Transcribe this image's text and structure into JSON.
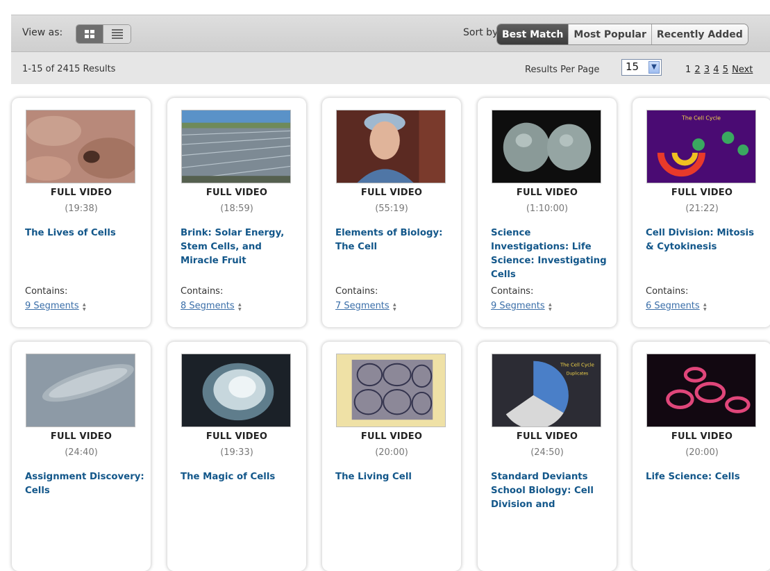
{
  "toolbar": {
    "view_label": "View as:",
    "view_modes": [
      {
        "name": "grid",
        "icon": "grid-icon",
        "active": true
      },
      {
        "name": "list",
        "icon": "list-icon",
        "active": false
      }
    ],
    "sort_label": "Sort by:",
    "sort_options": [
      "Best Match",
      "Most Popular",
      "Recently Added"
    ],
    "sort_active": "Best Match",
    "results_count": "1-15 of 2415 Results",
    "results_per_page_label": "Results Per Page",
    "results_per_page_value": "15",
    "pages": [
      "1",
      "2",
      "3",
      "4",
      "5"
    ],
    "current_page": "1",
    "next_label": "Next"
  },
  "cards": [
    {
      "type": "FULL VIDEO",
      "duration": "(19:38)",
      "title": "The Lives of Cells",
      "contains": "Contains:",
      "segments": "9 Segments",
      "thumb": "microscopic-cell-surface"
    },
    {
      "type": "FULL VIDEO",
      "duration": "(18:59)",
      "title": "Brink: Solar Energy, Stem Cells, and Miracle Fruit",
      "contains": "Contains:",
      "segments": "8 Segments",
      "thumb": "solar-panel-field"
    },
    {
      "type": "FULL VIDEO",
      "duration": "(55:19)",
      "title": "Elements of Biology: The Cell",
      "contains": "Contains:",
      "segments": "7 Segments",
      "thumb": "surgeon-portrait"
    },
    {
      "type": "FULL VIDEO",
      "duration": "(1:10:00)",
      "title": "Science Investigations: Life Science: Investigating Cells",
      "contains": "Contains:",
      "segments": "9 Segments",
      "thumb": "dividing-cells"
    },
    {
      "type": "FULL VIDEO",
      "duration": "(21:22)",
      "title": "Cell Division: Mitosis & Cytokinesis",
      "contains": "Contains:",
      "segments": "6 Segments",
      "thumb": "cell-cycle-diagram"
    },
    {
      "type": "FULL VIDEO",
      "duration": "(24:40)",
      "title": "Assignment Discovery: Cells",
      "thumb": "paramecium"
    },
    {
      "type": "FULL VIDEO",
      "duration": "(19:33)",
      "title": "The Magic of Cells",
      "thumb": "glowing-cell"
    },
    {
      "type": "FULL VIDEO",
      "duration": "(20:00)",
      "title": "The Living Cell",
      "thumb": "cork-cells"
    },
    {
      "type": "FULL VIDEO",
      "duration": "(24:50)",
      "title": "Standard Deviants School Biology: Cell Division and",
      "thumb": "cell-cycle-chart"
    },
    {
      "type": "FULL VIDEO",
      "duration": "(20:00)",
      "title": "Life Science: Cells",
      "thumb": "red-blood-cells"
    }
  ],
  "colors": {
    "title_link": "#13578a",
    "segment_link": "#3a6ea8",
    "active_sort_bg": "#4a4a4a",
    "toolbar_bg": "#e6e6e6"
  }
}
